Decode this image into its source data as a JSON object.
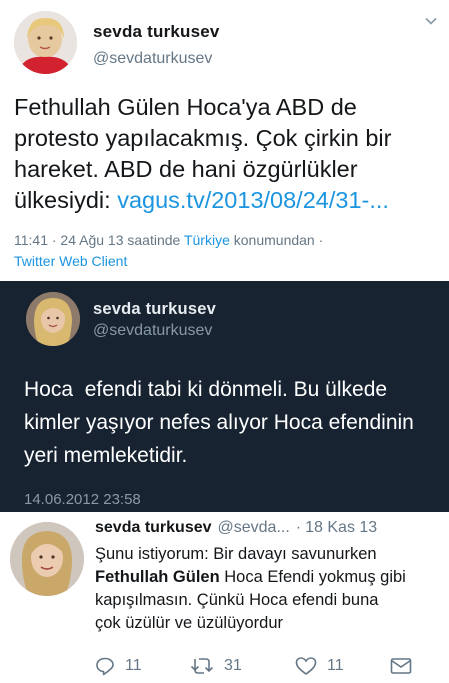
{
  "tweet1": {
    "name": "sevda turkusev",
    "handle": "@sevdaturkusev",
    "text_plain": "Fethullah Gülen Hoca'ya ABD de protesto yapılacakmış. Çok çirkin bir hareket. ABD de hani özgürlükler ülkesiydi: ",
    "link": "vagus.tv/2013/08/24/31-...",
    "meta_time": "11:41 · 24 Ağu 13 saatinde ",
    "meta_location": "Türkiye",
    "meta_suffix": " konumundan ·",
    "client": "Twitter Web Client",
    "icons": {
      "menu": "chevron-down-icon"
    }
  },
  "tweet2": {
    "name": "sevda turkusev",
    "handle": "@sevdaturkusev",
    "text": "Hoca  efendi tabi ki dönmeli. Bu ülkede kimler yaşıyor nefes alıyor Hoca efendinin yeri memleketidir.",
    "date": "14.06.2012 23:58"
  },
  "tweet3": {
    "name": "sevda turkusev",
    "handle": "@sevda...",
    "dot": "·",
    "time": "18 Kas 13",
    "line1": "Şunu istiyorum: Bir davayı savunurken",
    "line2_bold": "Fethullah Gülen",
    "line2_rest": " Hoca Efendi yokmuş gibi",
    "line3": "kapışılmasın. Çünkü Hoca efendi buna",
    "line4": "çok üzülür ve üzülüyordur",
    "actions": {
      "reply_count": "11",
      "retweet_count": "31",
      "like_count": "11"
    },
    "icons": {
      "reply": "reply-icon",
      "retweet": "retweet-icon",
      "like": "heart-icon",
      "dm": "envelope-icon"
    }
  },
  "colors": {
    "link_blue": "#1b95e0",
    "dark_bg": "#172331",
    "secondary_gray": "#657786"
  }
}
